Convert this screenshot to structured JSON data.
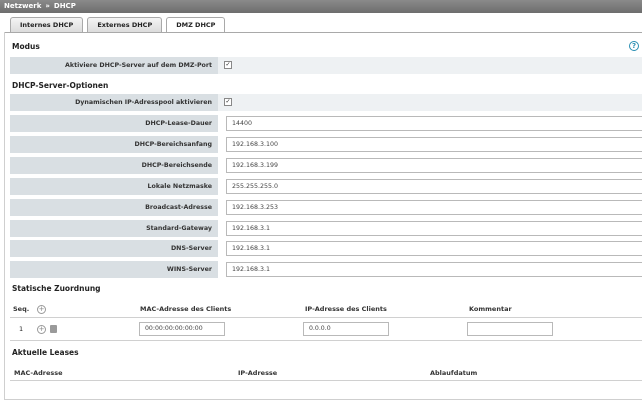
{
  "breadcrumb": {
    "section": "Netzwerk",
    "separator": "»",
    "page": "DHCP"
  },
  "tabs": [
    {
      "label": "Internes DHCP",
      "active": false
    },
    {
      "label": "Externes DHCP",
      "active": false
    },
    {
      "label": "DMZ DHCP",
      "active": true
    }
  ],
  "modus": {
    "title": "Modus",
    "enable_label": "Aktiviere DHCP-Server auf dem DMZ-Port",
    "enable_checked": true
  },
  "options": {
    "title": "DHCP-Server-Optionen",
    "dynamic_pool_label": "Dynamischen IP-Adresspool aktivieren",
    "dynamic_pool_checked": true,
    "fields": [
      {
        "label": "DHCP-Lease-Dauer",
        "value": "14400"
      },
      {
        "label": "DHCP-Bereichsanfang",
        "value": "192.168.3.100"
      },
      {
        "label": "DHCP-Bereichsende",
        "value": "192.168.3.199"
      },
      {
        "label": "Lokale Netzmaske",
        "value": "255.255.255.0"
      },
      {
        "label": "Broadcast-Adresse",
        "value": "192.168.3.253"
      },
      {
        "label": "Standard-Gateway",
        "value": "192.168.3.1"
      },
      {
        "label": "DNS-Server",
        "value": "192.168.3.1"
      },
      {
        "label": "WINS-Server",
        "value": "192.168.3.1"
      }
    ]
  },
  "static": {
    "title": "Statische Zuordnung",
    "columns": {
      "seq": "Seq.",
      "mac": "MAC-Adresse des Clients",
      "ip": "IP-Adresse des Clients",
      "comment": "Kommentar"
    },
    "rows": [
      {
        "seq": "1",
        "mac": "00:00:00:00:00:00",
        "ip": "0.0.0.0",
        "comment": ""
      }
    ]
  },
  "leases": {
    "title": "Aktuelle Leases",
    "columns": {
      "mac": "MAC-Adresse",
      "ip": "IP-Adresse",
      "expiry": "Ablaufdatum"
    }
  },
  "icons": {
    "help": "?",
    "add": "+",
    "checkmark": "✓"
  },
  "colors": {
    "label_bg": "#d9dfe3",
    "help_accent": "#2a8fb3",
    "titlebar": "#7a7a7a"
  }
}
